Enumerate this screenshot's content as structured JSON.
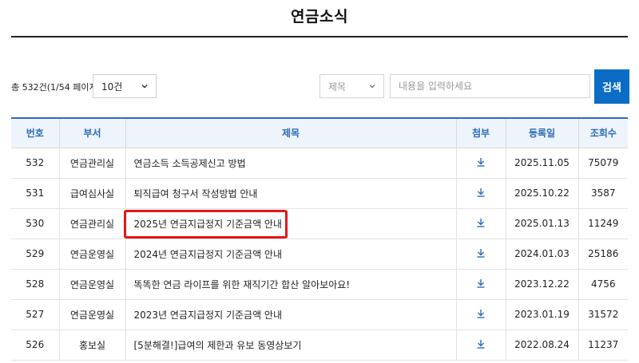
{
  "header": {
    "title": "연금소식"
  },
  "toolbar": {
    "total_text": "총 532건(1/54 페이지)",
    "page_size": "10건",
    "search_field": "제목",
    "search_placeholder": "내용을 입력하세요",
    "search_button": "검색"
  },
  "table": {
    "columns": [
      "번호",
      "부서",
      "제목",
      "첨부",
      "등록일",
      "조회수"
    ],
    "rows": [
      {
        "no": "532",
        "dept": "연금관리실",
        "title": "연금소득 소득공제신고 방법",
        "date": "2025.11.05",
        "views": "75079"
      },
      {
        "no": "531",
        "dept": "급여심사실",
        "title": "퇴직급여 청구서 작성방법 안내",
        "date": "2025.10.22",
        "views": "3587"
      },
      {
        "no": "530",
        "dept": "연금관리실",
        "title": "2025년 연금지급정지 기준금액 안내",
        "date": "2025.01.13",
        "views": "11249",
        "highlighted": true
      },
      {
        "no": "529",
        "dept": "연금운영실",
        "title": "2024년 연금지급정지 기준금액 안내",
        "date": "2024.01.03",
        "views": "25186"
      },
      {
        "no": "528",
        "dept": "연금운영실",
        "title": "똑똑한 연금 라이프를 위한 재직기간 합산 알아보아요!",
        "date": "2023.12.22",
        "views": "4756"
      },
      {
        "no": "527",
        "dept": "연금운영실",
        "title": "2023년 연금지급정지 기준금액 안내",
        "date": "2023.01.19",
        "views": "31572"
      },
      {
        "no": "526",
        "dept": "홍보실",
        "title": "[5분해결!]급여의 제한과 유보 동영상보기",
        "date": "2022.08.24",
        "views": "11237"
      }
    ]
  },
  "colors": {
    "accent": "#0a6cc4",
    "header_text": "#2a6bb8",
    "header_bg": "#edf4fb",
    "highlight": "#e5161a"
  },
  "icons": {
    "attachment": "download-icon",
    "dropdown": "chevron-down-icon"
  }
}
